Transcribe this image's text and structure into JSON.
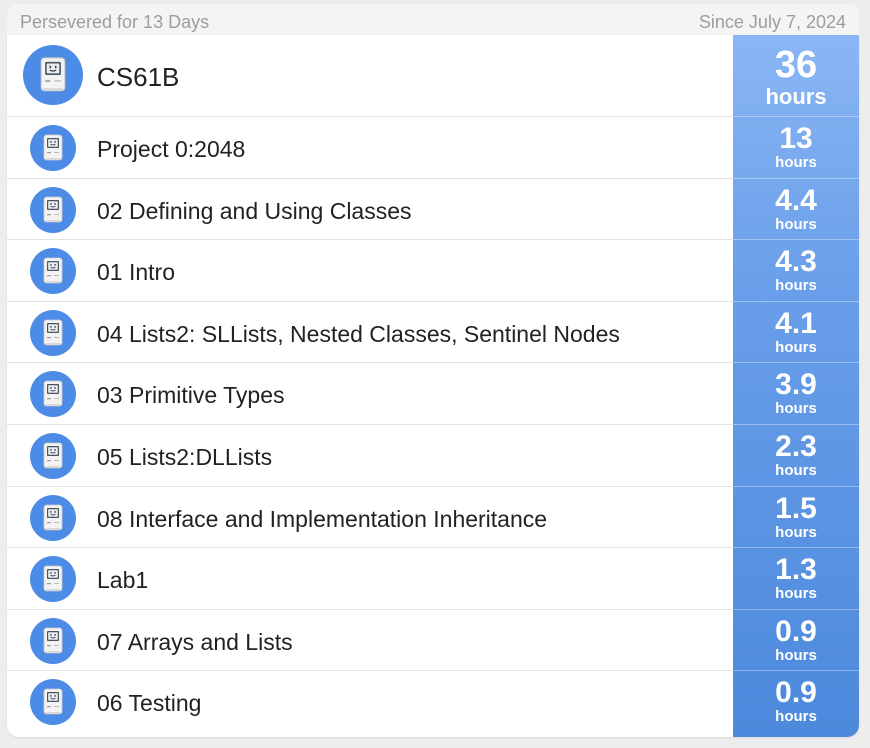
{
  "header": {
    "left_text": "Persevered for 13 Days",
    "right_text": "Since July 7, 2024"
  },
  "total": {
    "title": "CS61B",
    "value": "36",
    "unit": "hours",
    "icon": "classic-mac-icon"
  },
  "items": [
    {
      "label": "Project 0:2048",
      "value": "13",
      "unit": "hours",
      "icon": "classic-mac-icon"
    },
    {
      "label": "02 Defining and Using Classes",
      "value": "4.4",
      "unit": "hours",
      "icon": "classic-mac-icon"
    },
    {
      "label": "01 Intro",
      "value": "4.3",
      "unit": "hours",
      "icon": "classic-mac-icon"
    },
    {
      "label": "04 Lists2: SLLists, Nested Classes, Sentinel Nodes",
      "value": "4.1",
      "unit": "hours",
      "icon": "classic-mac-icon"
    },
    {
      "label": "03 Primitive Types",
      "value": "3.9",
      "unit": "hours",
      "icon": "classic-mac-icon"
    },
    {
      "label": "05 Lists2:DLLists",
      "value": "2.3",
      "unit": "hours",
      "icon": "classic-mac-icon"
    },
    {
      "label": "08 Interface and Implementation Inheritance",
      "value": "1.5",
      "unit": "hours",
      "icon": "classic-mac-icon"
    },
    {
      "label": "Lab1",
      "value": "1.3",
      "unit": "hours",
      "icon": "classic-mac-icon"
    },
    {
      "label": "07 Arrays and Lists",
      "value": "0.9",
      "unit": "hours",
      "icon": "classic-mac-icon"
    },
    {
      "label": "06 Testing",
      "value": "0.9",
      "unit": "hours",
      "icon": "classic-mac-icon"
    }
  ],
  "colors": {
    "accent": "#4c8ce6",
    "column_top": "#8ab6f4",
    "column_bottom": "#4c89dc"
  }
}
